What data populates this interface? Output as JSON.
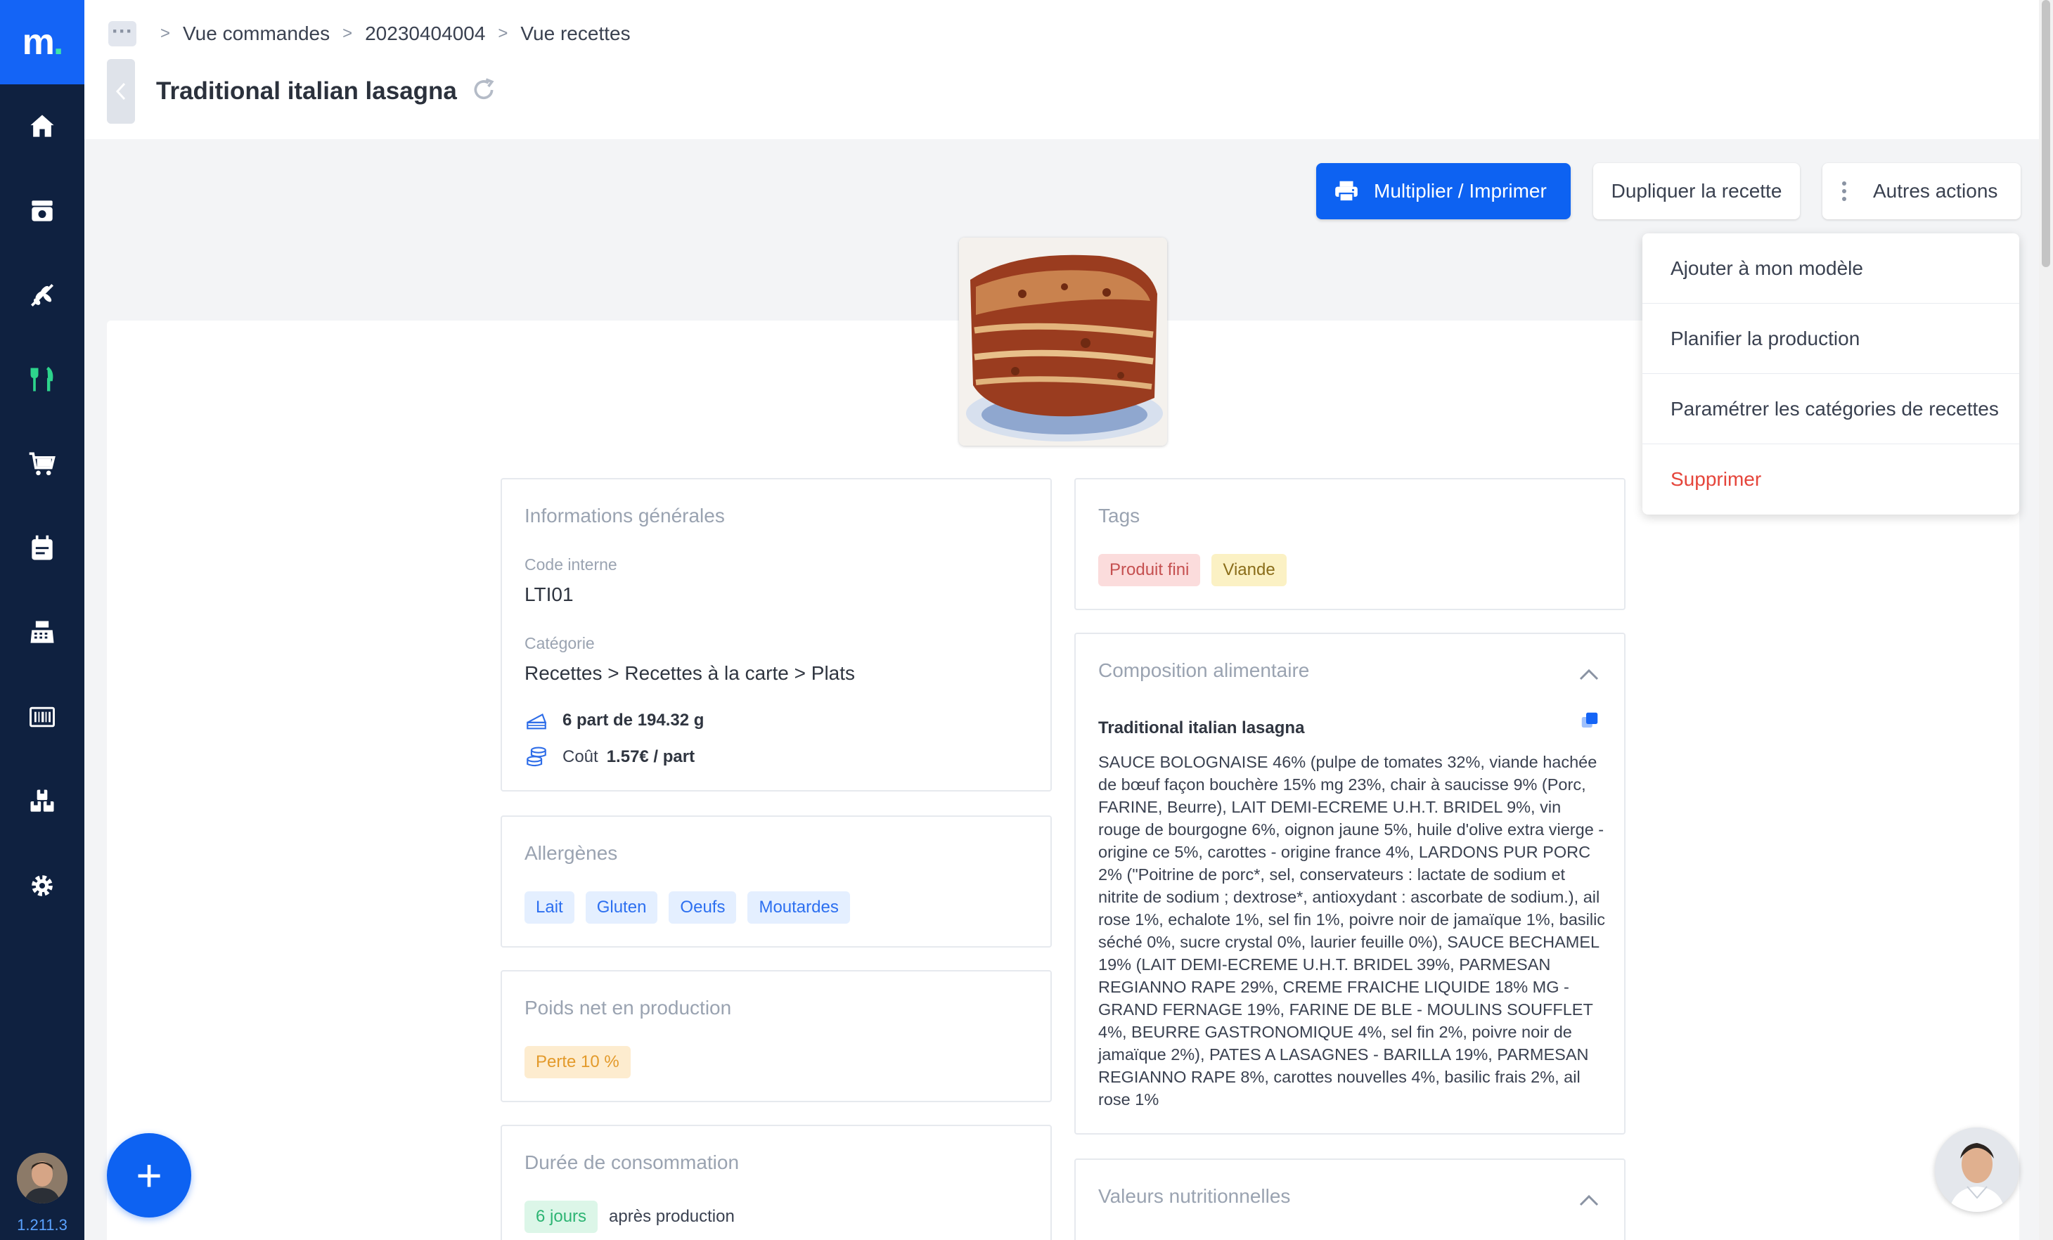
{
  "app": {
    "logo_text": "m",
    "version": "1.211.3"
  },
  "sidebar": {
    "items": [
      {
        "icon": "home-icon"
      },
      {
        "icon": "orders-icon"
      },
      {
        "icon": "ingredients-icon"
      },
      {
        "icon": "recipes-icon",
        "active": true
      },
      {
        "icon": "cart-icon"
      },
      {
        "icon": "planning-icon"
      },
      {
        "icon": "cash-register-icon"
      },
      {
        "icon": "barcode-icon"
      },
      {
        "icon": "stock-icon"
      },
      {
        "icon": "settings-icon"
      }
    ]
  },
  "breadcrumb": {
    "items": [
      "Vue commandes",
      "20230404004",
      "Vue recettes"
    ],
    "separator": ">"
  },
  "header": {
    "title": "Traditional italian lasagna"
  },
  "actions": {
    "primary_label": "Multiplier / Imprimer",
    "duplicate_label": "Dupliquer la recette",
    "more_label": "Autres actions"
  },
  "dropdown": {
    "items": [
      {
        "label": "Ajouter à mon modèle"
      },
      {
        "label": "Planifier la production"
      },
      {
        "label": "Paramétrer les catégories de recettes"
      },
      {
        "label": "Supprimer",
        "danger": true
      }
    ]
  },
  "general": {
    "title": "Informations générales",
    "code_label": "Code interne",
    "code_value": "LTI01",
    "category_label": "Catégorie",
    "category_value": "Recettes > Recettes à la carte > Plats",
    "portions": "6 part de 194.32 g",
    "cost_label": "Coût",
    "cost_value": "1.57€ / part"
  },
  "allergens": {
    "title": "Allergènes",
    "items": [
      "Lait",
      "Gluten",
      "Oeufs",
      "Moutardes"
    ]
  },
  "net_weight": {
    "title": "Poids net en production",
    "loss": "Perte 10 %"
  },
  "shelf_life": {
    "title": "Durée de consommation",
    "days": "6 jours",
    "suffix": "après production"
  },
  "tags": {
    "title": "Tags",
    "items": [
      "Produit fini",
      "Viande"
    ]
  },
  "composition": {
    "title": "Composition alimentaire",
    "recipe_name": "Traditional italian lasagna",
    "text": "SAUCE BOLOGNAISE 46% (pulpe de tomates 32%, viande hachée de bœuf façon bouchère 15% mg 23%, chair à saucisse 9% (Porc, FARINE, Beurre), LAIT DEMI-ECREME U.H.T. BRIDEL 9%, vin rouge de bourgogne 6%, oignon jaune 5%, huile d'olive extra vierge - origine ce 5%, carottes - origine france 4%, LARDONS PUR PORC 2% (\"Poitrine de porc*, sel, conservateurs : lactate de sodium et nitrite de sodium ; dextrose*, antioxydant : ascorbate de sodium.), ail rose 1%, echalote 1%, sel fin 1%, poivre noir de jamaïque 1%, basilic séché 0%, sucre crystal 0%, laurier feuille 0%), SAUCE BECHAMEL 19% (LAIT DEMI-ECREME U.H.T. BRIDEL 39%, PARMESAN REGIANNO RAPE 29%, CREME FRAICHE LIQUIDE 18% MG - GRAND FERNAGE 19%, FARINE DE BLE - MOULINS SOUFFLET 4%, BEURRE GASTRONOMIQUE 4%, sel fin 2%, poivre noir de jamaïque 2%), PATES A LASAGNES - BARILLA 19%, PARMESAN REGIANNO RAPE 8%, carottes nouvelles 4%, basilic frais 2%, ail rose 1%"
  },
  "nutrition": {
    "title": "Valeurs nutritionnelles"
  },
  "fab": {
    "label": "+"
  },
  "colors": {
    "primary": "#0d62f2",
    "sidebar": "#0f2140",
    "active_icon": "#2dd48c",
    "danger": "#e5453b"
  }
}
